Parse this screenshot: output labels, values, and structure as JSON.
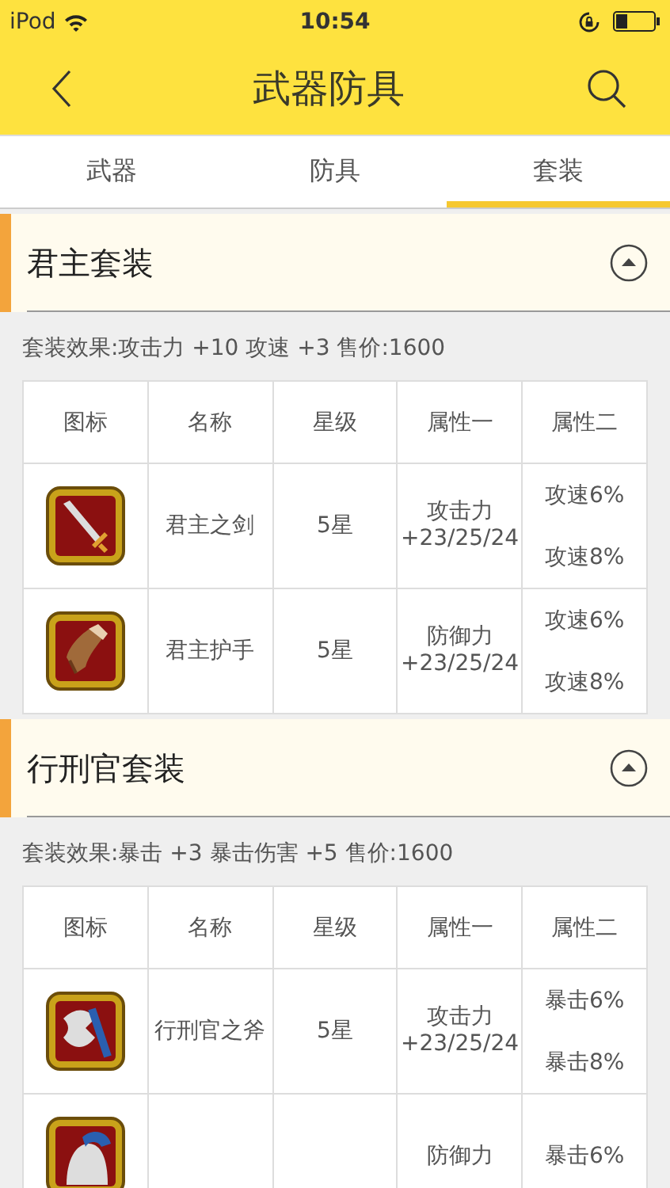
{
  "status_bar": {
    "carrier": "iPod",
    "time": "10:54"
  },
  "nav": {
    "title": "武器防具"
  },
  "tabs": [
    {
      "label": "武器",
      "selected": false
    },
    {
      "label": "防具",
      "selected": false
    },
    {
      "label": "套装",
      "selected": true
    }
  ],
  "sets": [
    {
      "title": "君主套装",
      "expanded": true,
      "effect": "套装效果:攻击力 +10  攻速 +3 售价:1600",
      "columns": [
        "图标",
        "名称",
        "星级",
        "属性一",
        "属性二"
      ],
      "rows": [
        {
          "kind": "sword",
          "name": "君主之剑",
          "stars_text": "5星",
          "attr1": [
            "攻击力",
            "+23/25/24"
          ],
          "attr2": [
            "攻速6%",
            "攻速8%"
          ]
        },
        {
          "kind": "glove",
          "name": "君主护手",
          "stars_text": "5星",
          "attr1": [
            "防御力",
            "+23/25/24"
          ],
          "attr2": [
            "攻速6%",
            "攻速8%"
          ]
        }
      ]
    },
    {
      "title": "行刑官套装",
      "expanded": true,
      "effect": "套装效果:暴击 +3  暴击伤害 +5 售价:1600",
      "columns": [
        "图标",
        "名称",
        "星级",
        "属性一",
        "属性二"
      ],
      "rows": [
        {
          "kind": "axe",
          "name": "行刑官之斧",
          "stars_text": "5星",
          "attr1": [
            "攻击力",
            "+23/25/24"
          ],
          "attr2": [
            "暴击6%",
            "暴击8%"
          ]
        },
        {
          "kind": "helm",
          "attr1": [
            "防御力"
          ],
          "attr2": [
            "暴击6%"
          ]
        }
      ]
    }
  ]
}
